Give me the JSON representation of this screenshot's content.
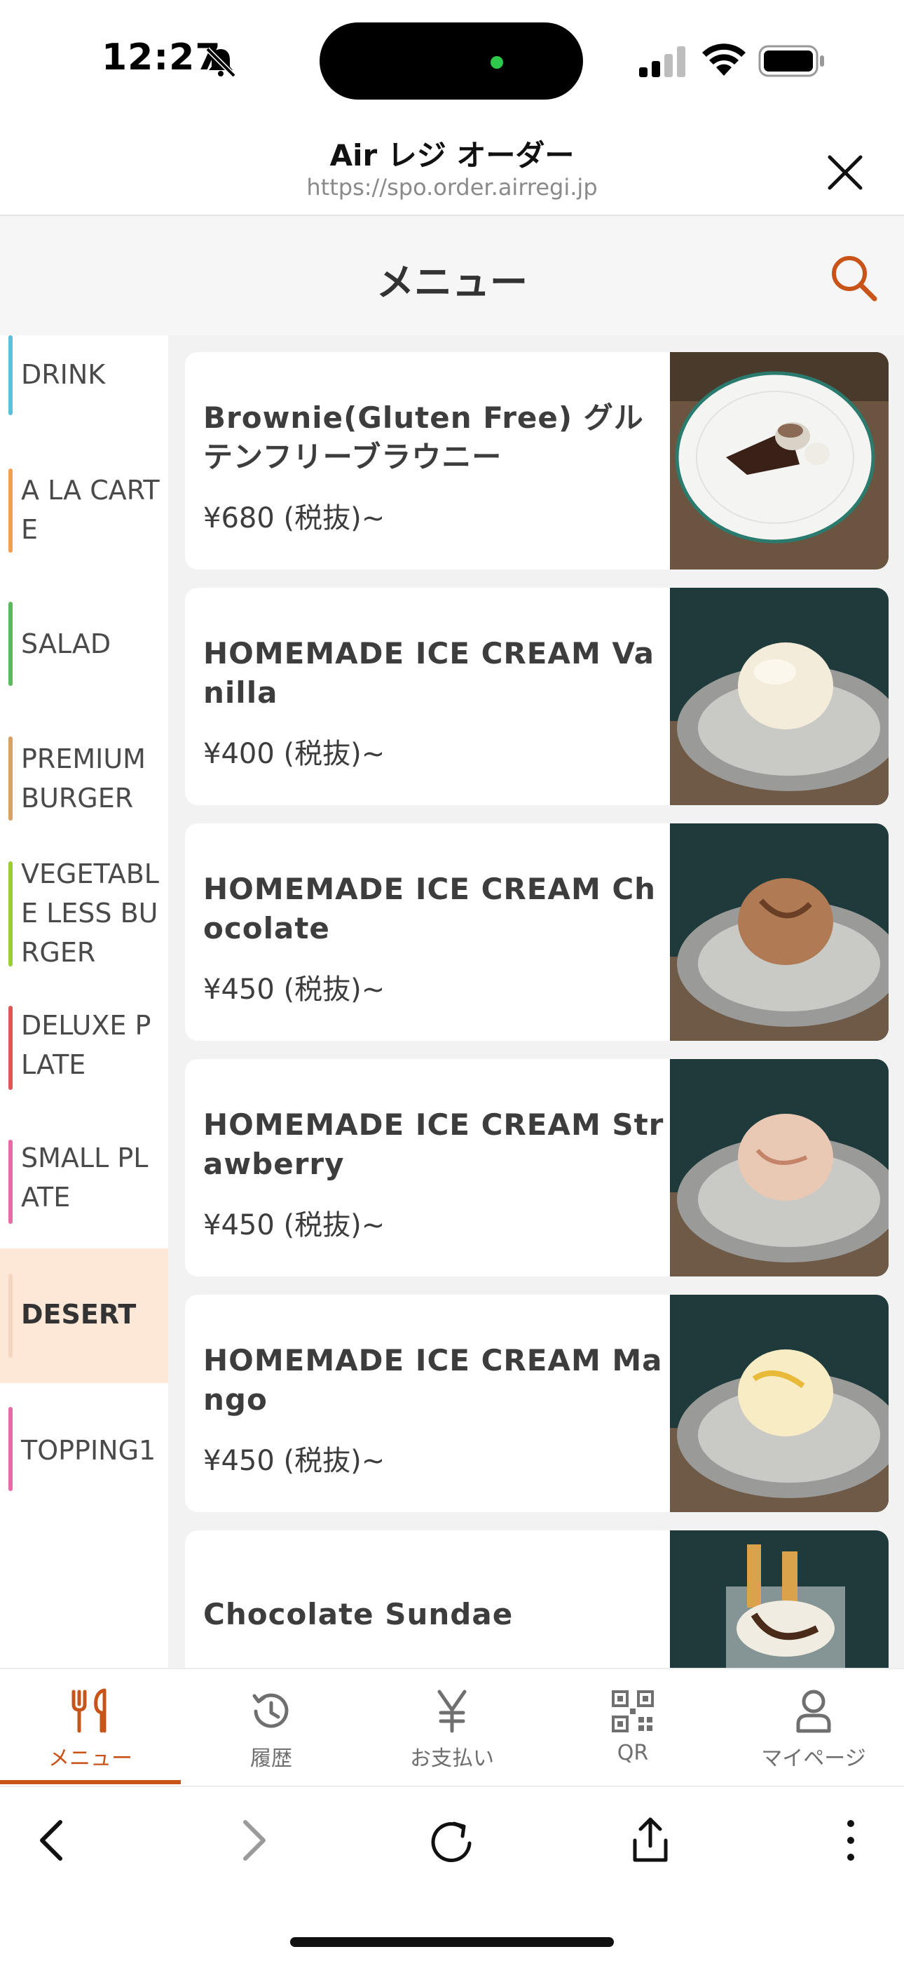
{
  "status": {
    "time": "12:27"
  },
  "browser": {
    "title": "Air レジ オーダー",
    "url": "https://spo.order.airregi.jp"
  },
  "page": {
    "title": "メニュー"
  },
  "categories": [
    {
      "label": "DRINK",
      "color": "#5bc0de"
    },
    {
      "label": "A LA CARTE",
      "color": "#f0a050"
    },
    {
      "label": "SALAD",
      "color": "#5cb85c"
    },
    {
      "label": "PREMIUM BURGER",
      "color": "#d9a066"
    },
    {
      "label": "VEGETABLE LESS BURGER",
      "color": "#9acd32"
    },
    {
      "label": "DELUXE PLATE",
      "color": "#e05555"
    },
    {
      "label": "SMALL PLATE",
      "color": "#e86aa6"
    },
    {
      "label": "DESERT",
      "color": "#f4d6c0",
      "active": true
    },
    {
      "label": "TOPPING1",
      "color": "#e86aa6"
    }
  ],
  "products": [
    {
      "name": "Brownie(Gluten Free) グルテンフリーブラウニー",
      "price": "¥680 (税抜)~",
      "image": "brownie-plate"
    },
    {
      "name": "HOMEMADE ICE CREAM Vanilla",
      "price": "¥400 (税抜)~",
      "image": "vanilla-scoop"
    },
    {
      "name": "HOMEMADE ICE CREAM Chocolate",
      "price": "¥450 (税抜)~",
      "image": "chocolate-scoop"
    },
    {
      "name": "HOMEMADE ICE CREAM Strawberry",
      "price": "¥450 (税抜)~",
      "image": "strawberry-scoop"
    },
    {
      "name": "HOMEMADE ICE CREAM Mango",
      "price": "¥450 (税抜)~",
      "image": "mango-scoop"
    },
    {
      "name": "Chocolate Sundae",
      "price": "",
      "image": "sundae-glass"
    }
  ],
  "tabs": [
    {
      "label": "メニュー",
      "icon": "fork-knife-icon",
      "active": true
    },
    {
      "label": "履歴",
      "icon": "history-icon"
    },
    {
      "label": "お支払い",
      "icon": "yen-icon"
    },
    {
      "label": "QR",
      "icon": "qr-code-icon"
    },
    {
      "label": "マイページ",
      "icon": "person-icon"
    }
  ],
  "colors": {
    "accent": "#c8541a",
    "active_category_bg": "#fde8d8",
    "list_bg": "#f2f2f2"
  }
}
